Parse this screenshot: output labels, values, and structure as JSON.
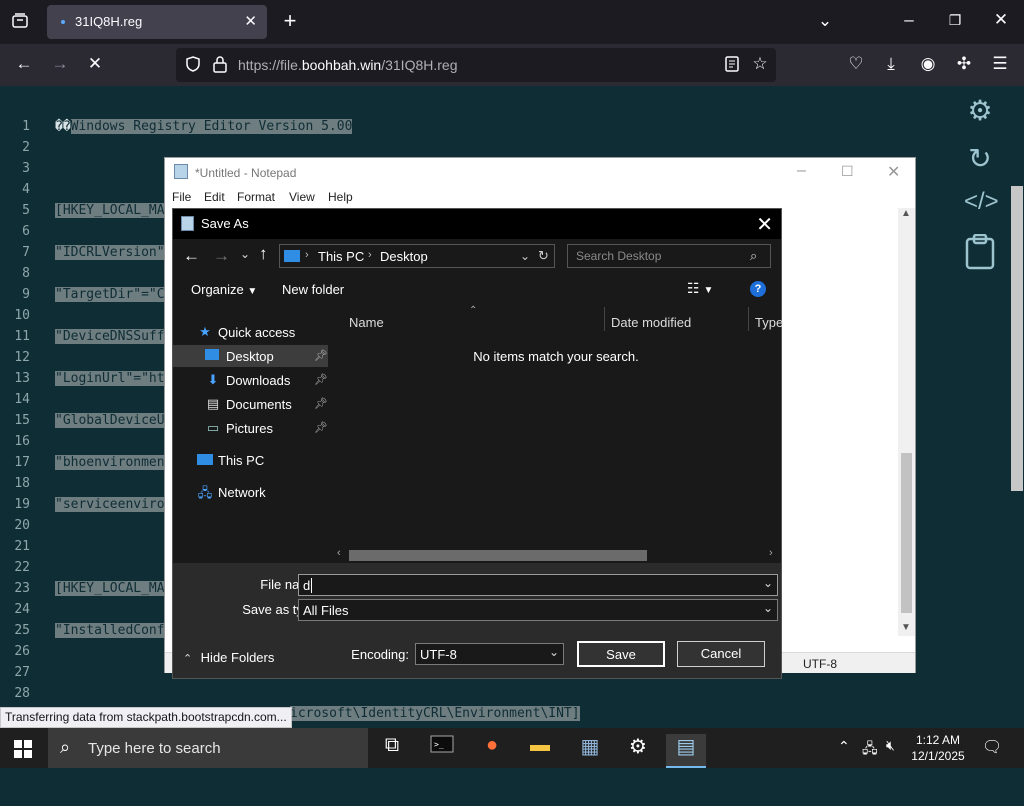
{
  "browser": {
    "tab_title": "31IQ8H.reg",
    "url_prefix": "https://file.",
    "url_domain": "boohbah.win",
    "url_path": "/31IQ8H.reg",
    "status_link": "Transferring data from stackpath.bootstrapcdn.com..."
  },
  "code": {
    "line_numbers": [
      "1",
      "2",
      "3",
      "4",
      "5",
      "6",
      "7",
      "8",
      "9",
      "10",
      "11",
      "12",
      "13",
      "14",
      "15",
      "16",
      "17",
      "18",
      "19",
      "20",
      "21",
      "22",
      "23",
      "24",
      "25",
      "26",
      "27",
      "28"
    ],
    "line1_prefix": "��",
    "line1_text": "Windows Registry Editor Version 5.00",
    "line5": "[HKEY_LOCAL_MA",
    "line7": "\"IDCRLVersion\"",
    "line9": "\"TargetDir\"=\"C",
    "line11": "\"DeviceDNSSuff",
    "line13": "\"LoginUrl\"=\"ht",
    "line15": "\"GlobalDeviceU",
    "line17": "\"bhoenvironmen",
    "line19": "\"serviceenviro",
    "line23": "[HKEY_LOCAL_MA",
    "line25": "\"InstalledConf",
    "line29_tail": "icrosoft\\IdentityCRL\\Environment\\INT]"
  },
  "notepad": {
    "title": "*Untitled - Notepad",
    "menu": [
      "File",
      "Edit",
      "Format",
      "View",
      "Help"
    ],
    "encoding": "UTF-8"
  },
  "save_as": {
    "title": "Save As",
    "crumbs": [
      "This PC",
      "Desktop"
    ],
    "search_placeholder": "Search Desktop",
    "organize": "Organize",
    "new_folder": "New folder",
    "nav": {
      "quick_access": "Quick access",
      "desktop": "Desktop",
      "downloads": "Downloads",
      "documents": "Documents",
      "pictures": "Pictures",
      "this_pc": "This PC",
      "network": "Network"
    },
    "columns": [
      "Name",
      "Date modified",
      "Type"
    ],
    "empty_message": "No items match your search.",
    "file_name_label": "File name:",
    "file_name_value": "d",
    "save_type_label": "Save as type:",
    "save_type_value": "All Files",
    "encoding_label": "Encoding:",
    "encoding_value": "UTF-8",
    "hide_folders": "Hide Folders",
    "save_button": "Save",
    "cancel_button": "Cancel"
  },
  "taskbar": {
    "search_placeholder": "Type here to search",
    "time": "1:12 AM",
    "date": "12/1/2025"
  }
}
